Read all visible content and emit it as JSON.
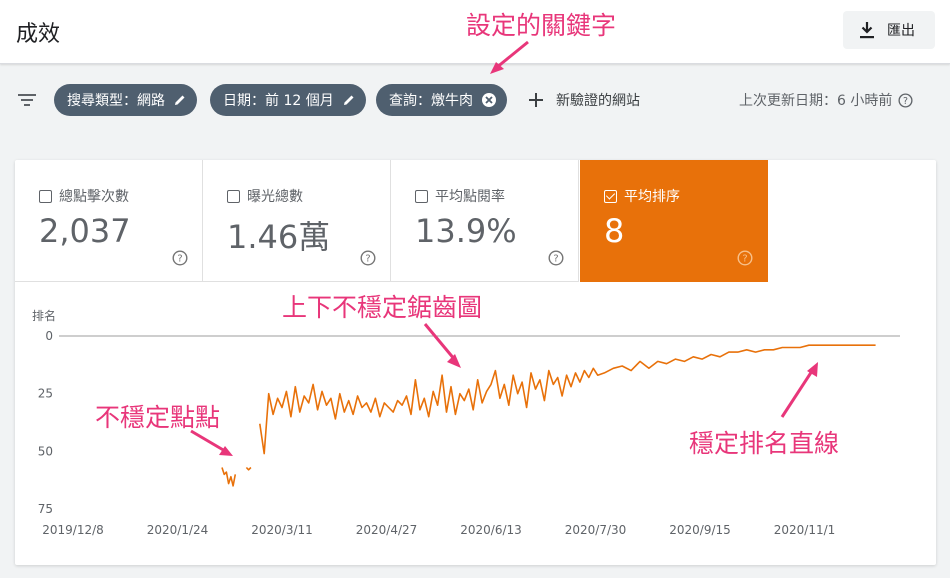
{
  "header": {
    "title": "成效",
    "export_label": "匯出"
  },
  "annotations": {
    "keyword_setting": "設定的關鍵字",
    "sawtooth": "上下不穩定鋸齒圖",
    "unstable_dots": "不穩定點點",
    "stable_line": "穩定排名直線"
  },
  "filters": {
    "chips": [
      {
        "label": "搜尋類型：網路",
        "action_icon": "pencil-icon"
      },
      {
        "label": "日期：前 12 個月",
        "action_icon": "pencil-icon"
      },
      {
        "label": "查詢：燉牛肉",
        "action_icon": "close-circle-icon"
      }
    ],
    "add_label": "新驗證的網站",
    "last_update": "上次更新日期：6 小時前"
  },
  "metrics": [
    {
      "label": "總點擊次數",
      "value": "2,037",
      "checked": false
    },
    {
      "label": "曝光總數",
      "value": "1.46萬",
      "checked": false
    },
    {
      "label": "平均點閱率",
      "value": "13.9%",
      "checked": false
    },
    {
      "label": "平均排序",
      "value": "8",
      "checked": true
    }
  ],
  "colors": {
    "accent": "#e8710a",
    "chip": "#4f5f6f",
    "annotation": "#e8367a"
  },
  "chart_data": {
    "type": "line",
    "ylabel": "排名",
    "y_reversed": true,
    "ylim": [
      0,
      75
    ],
    "y_ticks": [
      "0",
      "25",
      "50",
      "75"
    ],
    "x_ticks": [
      "2019/12/8",
      "2020/1/24",
      "2020/3/11",
      "2020/4/27",
      "2020/6/13",
      "2020/7/30",
      "2020/9/15",
      "2020/11/1"
    ],
    "series": [
      {
        "color": "#e8710a",
        "segments": [
          {
            "x": [
              "2020-02-13",
              "2020-02-14",
              "2020-02-15",
              "2020-02-16",
              "2020-02-17",
              "2020-02-18",
              "2020-02-19"
            ],
            "y": [
              57,
              60,
              59,
              64,
              61,
              65,
              60
            ]
          },
          {
            "x": [
              "2020-02-24",
              "2020-02-25",
              "2020-02-26"
            ],
            "y": [
              57,
              58,
              57
            ]
          },
          {
            "x": [
              "2020-03-01",
              "2020-03-03",
              "2020-03-05",
              "2020-03-07",
              "2020-03-09",
              "2020-03-11",
              "2020-03-13",
              "2020-03-15",
              "2020-03-17",
              "2020-03-19",
              "2020-03-21",
              "2020-03-23",
              "2020-03-25",
              "2020-03-27",
              "2020-03-29",
              "2020-03-31",
              "2020-04-02",
              "2020-04-04",
              "2020-04-06",
              "2020-04-08",
              "2020-04-10",
              "2020-04-12",
              "2020-04-14",
              "2020-04-16",
              "2020-04-18",
              "2020-04-20",
              "2020-04-22",
              "2020-04-24",
              "2020-04-26",
              "2020-04-28",
              "2020-04-30",
              "2020-05-02",
              "2020-05-04",
              "2020-05-06",
              "2020-05-08",
              "2020-05-10",
              "2020-05-12",
              "2020-05-14",
              "2020-05-16",
              "2020-05-18",
              "2020-05-20",
              "2020-05-22",
              "2020-05-24",
              "2020-05-26",
              "2020-05-28",
              "2020-05-30",
              "2020-06-01",
              "2020-06-03",
              "2020-06-05",
              "2020-06-07",
              "2020-06-09",
              "2020-06-11",
              "2020-06-13",
              "2020-06-15",
              "2020-06-17",
              "2020-06-19",
              "2020-06-21",
              "2020-06-23",
              "2020-06-25",
              "2020-06-27",
              "2020-06-29",
              "2020-07-01",
              "2020-07-03",
              "2020-07-05",
              "2020-07-07",
              "2020-07-09",
              "2020-07-11",
              "2020-07-13",
              "2020-07-15",
              "2020-07-17",
              "2020-07-19",
              "2020-07-21",
              "2020-07-23",
              "2020-07-25",
              "2020-07-27",
              "2020-07-29",
              "2020-07-31",
              "2020-08-03",
              "2020-08-07",
              "2020-08-11",
              "2020-08-15",
              "2020-08-19",
              "2020-08-23",
              "2020-08-27",
              "2020-08-31",
              "2020-09-04",
              "2020-09-08",
              "2020-09-12",
              "2020-09-16",
              "2020-09-20",
              "2020-09-24",
              "2020-09-28",
              "2020-10-02",
              "2020-10-06",
              "2020-10-10",
              "2020-10-14",
              "2020-10-18",
              "2020-10-22",
              "2020-10-26",
              "2020-10-30",
              "2020-11-03",
              "2020-11-07",
              "2020-11-11",
              "2020-11-15",
              "2020-11-19",
              "2020-11-23",
              "2020-11-27",
              "2020-12-01",
              "2020-12-03"
            ],
            "y": [
              38,
              51,
              25,
              34,
              27,
              31,
              24,
              35,
              22,
              33,
              26,
              29,
              21,
              32,
              24,
              30,
              27,
              36,
              25,
              33,
              28,
              34,
              26,
              31,
              29,
              33,
              27,
              35,
              29,
              31,
              33,
              28,
              30,
              26,
              34,
              19,
              32,
              27,
              35,
              24,
              30,
              17,
              33,
              22,
              34,
              25,
              28,
              23,
              32,
              19,
              29,
              24,
              21,
              15,
              27,
              21,
              30,
              17,
              25,
              20,
              31,
              16,
              23,
              19,
              28,
              15,
              21,
              18,
              26,
              17,
              22,
              16,
              20,
              15,
              18,
              14,
              17,
              16,
              14,
              13,
              15,
              11,
              14,
              11,
              12,
              10,
              11,
              9,
              10,
              8,
              9,
              7,
              7,
              6,
              7,
              6,
              6,
              5,
              5,
              5,
              4,
              4,
              4,
              4,
              4,
              4,
              4,
              4,
              4
            ]
          }
        ]
      }
    ],
    "grid": false
  }
}
